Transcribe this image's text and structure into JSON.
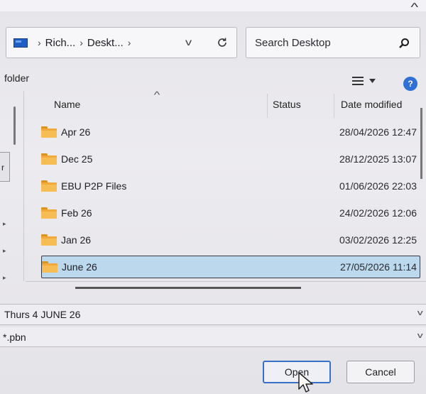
{
  "window": {
    "collapse_icon": "chevron-up-icon"
  },
  "address_bar": {
    "location_icon": "computer-icon",
    "breadcrumb": [
      "Rich...",
      "Deskt..."
    ],
    "separator": "›",
    "dropdown_icon": "chevron-down-icon",
    "refresh_icon": "refresh-icon"
  },
  "search": {
    "placeholder": "Search Desktop",
    "icon": "search-icon"
  },
  "toolbar": {
    "label": "folder",
    "view_icon": "list-view-icon",
    "help_label": "?"
  },
  "columns": {
    "name": "Name",
    "status": "Status",
    "date_modified": "Date modified",
    "sort_icon": "sort-up-icon"
  },
  "files": [
    {
      "name": "Apr 26",
      "date": "28/04/2026 12:47",
      "selected": false
    },
    {
      "name": "Dec 25",
      "date": "28/12/2025 13:07",
      "selected": false
    },
    {
      "name": "EBU P2P Files",
      "date": "01/06/2026 22:03",
      "selected": false
    },
    {
      "name": "Feb 26",
      "date": "24/02/2026 12:06",
      "selected": false
    },
    {
      "name": "Jan 26",
      "date": "03/02/2026 12:25",
      "selected": false
    },
    {
      "name": "June 26",
      "date": "27/05/2026 11:14",
      "selected": true
    }
  ],
  "file_name_field": {
    "value": "Thurs 4 JUNE 26"
  },
  "file_type_field": {
    "value": "*.pbn"
  },
  "buttons": {
    "open": "Open",
    "cancel": "Cancel"
  },
  "nav_fragment": {
    "label": "r"
  },
  "colors": {
    "selection": "#bcd8ec",
    "folder": "#f0a93a",
    "accent": "#2f6fd6"
  }
}
